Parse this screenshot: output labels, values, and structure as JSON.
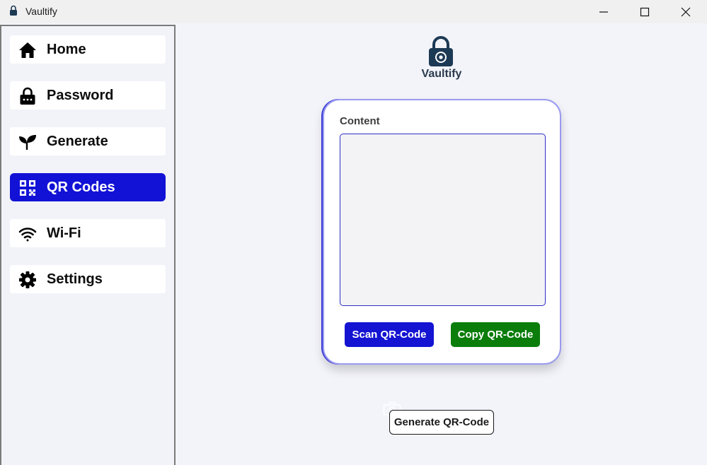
{
  "window": {
    "title": "Vaultify",
    "controls": {
      "minimize": "minimize-icon",
      "maximize": "maximize-icon",
      "close": "close-icon"
    }
  },
  "sidebar": {
    "items": [
      {
        "label": "Home",
        "icon": "home-icon",
        "active": false
      },
      {
        "label": "Password",
        "icon": "lock-icon",
        "active": false
      },
      {
        "label": "Generate",
        "icon": "sprout-icon",
        "active": false
      },
      {
        "label": "QR Codes",
        "icon": "qr-code-icon",
        "active": true
      },
      {
        "label": "Wi-Fi",
        "icon": "wifi-icon",
        "active": false
      },
      {
        "label": "Settings",
        "icon": "gear-icon",
        "active": false
      }
    ]
  },
  "header": {
    "logo_text": "Vaultify",
    "logo_icon": "lock-logo-icon"
  },
  "card": {
    "content_label": "Content",
    "content_value": "",
    "scan_label": "Scan QR-Code",
    "copy_label": "Copy QR-Code"
  },
  "generate": {
    "label": "Generate QR-Code",
    "icon": "camera-icon"
  },
  "colors": {
    "accent": "#1414d2",
    "copy_button": "#0a7d0a",
    "background": "#f3f4fa",
    "logo": "#1d3a55"
  }
}
